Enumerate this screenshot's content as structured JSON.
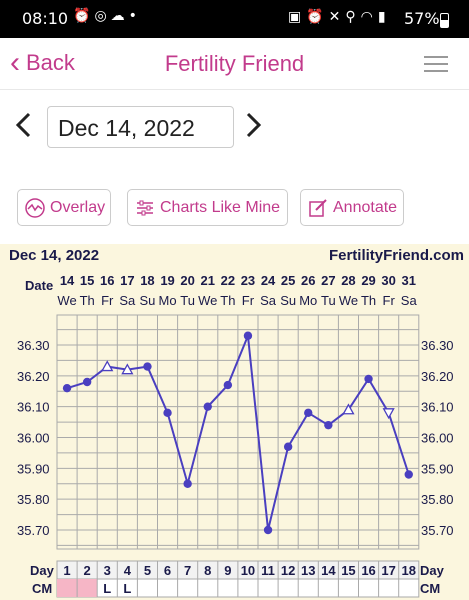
{
  "status_bar": {
    "time": "08:10",
    "battery": "57%",
    "left_icons": [
      "alarm-icon",
      "instagram-icon",
      "cloud-icon",
      "dot-icon"
    ],
    "right_icons": [
      "lock-icon",
      "alarm-icon",
      "mute-icon",
      "location-icon",
      "wifi-icon",
      "signal-icon"
    ]
  },
  "nav": {
    "back_label": "Back",
    "title": "Fertility Friend"
  },
  "date_nav": {
    "current_date": "Dec 14, 2022"
  },
  "actions": {
    "overlay_label": "Overlay",
    "charts_like_mine_label": "Charts Like Mine",
    "annotate_label": "Annotate"
  },
  "chart_header": {
    "date": "Dec 14, 2022",
    "site": "FertilityFriend.com"
  },
  "colors": {
    "accent": "#c23b8c",
    "chart_line": "#4a3fc0",
    "chart_bg": "#fbf6de",
    "cm_highlight": "#f6b6c6"
  },
  "chart_data": {
    "type": "line",
    "row_labels": {
      "date": "Date",
      "day": "Day",
      "cm": "CM"
    },
    "dates": [
      "14",
      "15",
      "16",
      "17",
      "18",
      "19",
      "20",
      "21",
      "22",
      "23",
      "24",
      "25",
      "26",
      "27",
      "28",
      "29",
      "30",
      "31"
    ],
    "weekdays": [
      "We",
      "Th",
      "Fr",
      "Sa",
      "Su",
      "Mo",
      "Tu",
      "We",
      "Th",
      "Fr",
      "Sa",
      "Su",
      "Mo",
      "Tu",
      "We",
      "Th",
      "Fr",
      "Sa"
    ],
    "cycle_days": [
      "1",
      "2",
      "3",
      "4",
      "5",
      "6",
      "7",
      "8",
      "9",
      "10",
      "11",
      "12",
      "13",
      "14",
      "15",
      "16",
      "17",
      "18"
    ],
    "cm": [
      "",
      "",
      "L",
      "L",
      "",
      "",
      "",
      "",
      "",
      "",
      "",
      "",
      "",
      "",
      "",
      "",
      "",
      ""
    ],
    "cm_highlight_days": [
      1,
      2
    ],
    "y_ticks": [
      "36.30",
      "36.20",
      "36.10",
      "36.00",
      "35.90",
      "35.80",
      "35.70"
    ],
    "ylim": [
      35.65,
      36.35
    ],
    "series": [
      {
        "values": [
          36.16,
          36.18,
          36.23,
          36.22,
          36.23,
          36.08,
          35.85,
          36.1,
          36.17,
          36.33,
          35.7,
          35.97,
          36.08,
          36.04,
          36.09,
          36.19,
          36.08,
          35.88
        ],
        "markers": [
          "dot",
          "dot",
          "open-triangle",
          "open-triangle",
          "dot",
          "dot",
          "dot",
          "dot",
          "dot",
          "dot",
          "dot",
          "dot",
          "dot",
          "dot",
          "open-triangle",
          "dot",
          "open-triangle-down",
          "dot"
        ]
      }
    ],
    "grid": true
  }
}
